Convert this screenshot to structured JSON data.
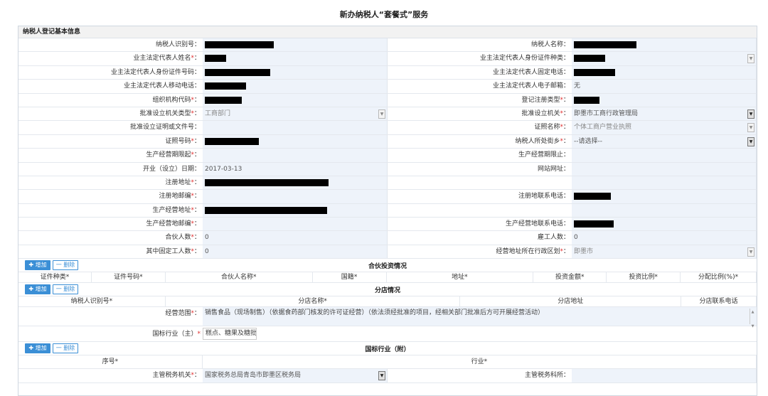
{
  "page_title": "新办纳税人“套餐式”服务",
  "basic": {
    "title": "纳税人登记基本信息",
    "rows": [
      [
        {
          "label": "纳税人识别号",
          "req": false,
          "value": "",
          "redact": 97
        },
        {
          "label": "纳税人名称",
          "req": false,
          "value": "",
          "redact": 88
        }
      ],
      [
        {
          "label": "业主法定代表人姓名",
          "req": true,
          "value": "",
          "redact": 30
        },
        {
          "label": "业主法定代表人身份证件种类",
          "req": false,
          "value": "",
          "redact": 44,
          "select": true
        }
      ],
      [
        {
          "label": "业主法定代表人身份证件号码",
          "req": false,
          "value": "",
          "redact": 92
        },
        {
          "label": "业主法定代表人固定电话",
          "req": false,
          "value": "",
          "redact": 58
        }
      ],
      [
        {
          "label": "业主法定代表人移动电话",
          "req": false,
          "value": "",
          "redact": 58
        },
        {
          "label": "业主法定代表人电子邮箱",
          "req": false,
          "value": "无"
        }
      ],
      [
        {
          "label": "组织机构代码",
          "req": true,
          "value": "",
          "redact": 52
        },
        {
          "label": "登记注册类型",
          "req": true,
          "value": "",
          "redact": 36
        }
      ],
      [
        {
          "label": "批准设立机关类型",
          "req": true,
          "value": "工商部门",
          "grey": true,
          "select": true
        },
        {
          "label": "批准设立机关",
          "req": true,
          "value": "即墨市工商行政管理局",
          "select": true,
          "dark": true
        }
      ],
      [
        {
          "label": "批准设立证明或文件号",
          "req": false,
          "value": ""
        },
        {
          "label": "证照名称",
          "req": true,
          "value": "个体工商户营业执照",
          "grey": true,
          "select": true
        }
      ],
      [
        {
          "label": "证照号码",
          "req": true,
          "value": "",
          "redact": 76
        },
        {
          "label": "纳税人所处街乡",
          "req": true,
          "value": "--请选择--",
          "select": true,
          "dark": true
        }
      ],
      [
        {
          "label": "生产经营期限起",
          "req": true,
          "value": ""
        },
        {
          "label": "生产经营期限止",
          "req": false,
          "value": ""
        }
      ],
      [
        {
          "label": "开业（设立）日期",
          "req": false,
          "value": "2017-03-13"
        },
        {
          "label": "网站网址",
          "req": false,
          "value": ""
        }
      ],
      [
        {
          "label": "注册地址",
          "req": true,
          "value": "",
          "redact": 174
        },
        {
          "label": "",
          "req": false,
          "value": ""
        }
      ],
      [
        {
          "label": "注册地邮编",
          "req": true,
          "value": ""
        },
        {
          "label": "注册地联系电话",
          "req": false,
          "value": "",
          "redact": 52
        }
      ],
      [
        {
          "label": "生产经营地址",
          "req": true,
          "value": "",
          "redact": 172
        },
        {
          "label": "",
          "req": false,
          "value": ""
        }
      ],
      [
        {
          "label": "生产经营地邮编",
          "req": true,
          "value": ""
        },
        {
          "label": "生产经营地联系电话",
          "req": false,
          "value": "",
          "redact": 56
        }
      ],
      [
        {
          "label": "合伙人数",
          "req": true,
          "value": "0"
        },
        {
          "label": "雇工人数",
          "req": false,
          "value": "0"
        }
      ],
      [
        {
          "label": "其中固定工人数",
          "req": true,
          "value": "0"
        },
        {
          "label": "经营地址所在行政区划",
          "req": true,
          "value": "即墨市",
          "grey": true,
          "select": true
        }
      ]
    ]
  },
  "buttons": {
    "add": "✚ 增加",
    "del": "一 删除"
  },
  "partner": {
    "title": "合伙投资情况",
    "columns": [
      {
        "label": "证件种类",
        "req": true,
        "w": 103
      },
      {
        "label": "证件号码",
        "req": true,
        "w": 104
      },
      {
        "label": "合伙人名称",
        "req": true,
        "w": 207
      },
      {
        "label": "国籍",
        "req": true,
        "w": 104
      },
      {
        "label": "地址",
        "req": true,
        "w": 207
      },
      {
        "label": "投资金额",
        "req": true,
        "w": 103
      },
      {
        "label": "投资比例",
        "req": true,
        "w": 104
      },
      {
        "label": "分配比例(%)",
        "req": true,
        "w": 107
      }
    ]
  },
  "branch": {
    "title": "分店情况",
    "columns": [
      {
        "label": "纳税人识别号",
        "req": true,
        "w": 207
      },
      {
        "label": "分店名称",
        "req": true,
        "w": 415
      },
      {
        "label": "分店地址",
        "req": false,
        "w": 311
      },
      {
        "label": "分店联系电话",
        "req": false,
        "w": 106
      }
    ]
  },
  "business_scope": {
    "label": "经营范围",
    "req": true,
    "value": "销售食品（现场制售）（依据食药部门核发的许可证经营）（依法须经批准的项目，经相关部门批准后方可开展经营活动）"
  },
  "main_industry": {
    "label": "国标行业（主）",
    "req": true,
    "value": "糕点、糖果及糖批"
  },
  "industry_sub": {
    "title": "国标行业（附）",
    "columns": [
      {
        "label": "序号",
        "req": true,
        "w": 259
      },
      {
        "label": "行业",
        "req": true,
        "w": 780
      }
    ]
  },
  "tax_row": [
    {
      "label": "主管税务机关",
      "req": true,
      "value": "国家税务总局青岛市即墨区税务局",
      "select": true,
      "dark": true
    },
    {
      "label": "主管税务科所",
      "req": false,
      "value": ""
    }
  ]
}
